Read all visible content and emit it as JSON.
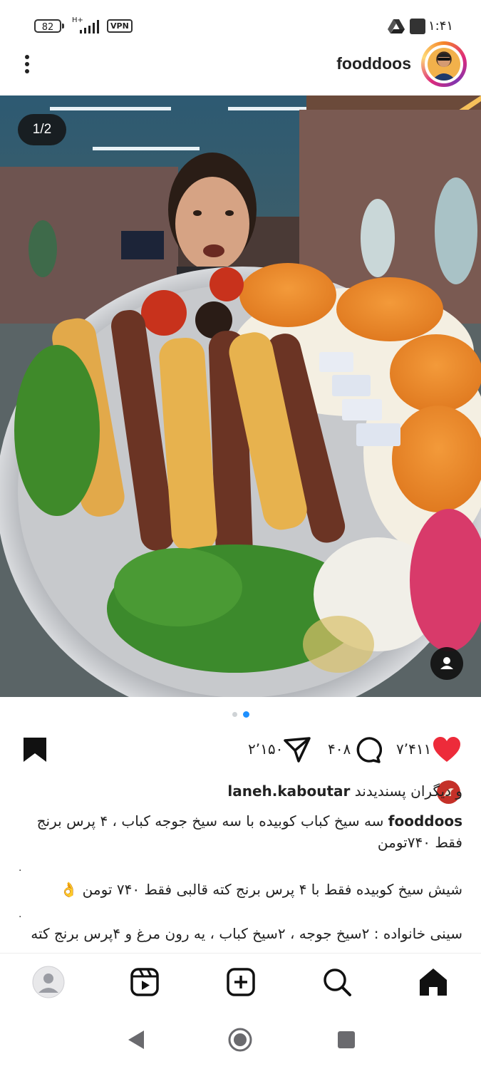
{
  "status_bar": {
    "battery": "82",
    "network_type": "H+",
    "vpn": "VPN",
    "time": "۱:۴۱"
  },
  "post_header": {
    "username": "fooddoos"
  },
  "photo": {
    "counter": "1/2",
    "description_icons": [
      "tag-people-icon"
    ]
  },
  "pagination": {
    "total": 2,
    "active_index": 1,
    "active_color": "#1e90ff",
    "inactive_color": "#cfd3d6"
  },
  "actions": {
    "likes": "۷٬۴۱۱",
    "comments": "۴۰۸",
    "shares": "۲٬۱۵۰",
    "like_color": "#ed2b3a"
  },
  "caption": {
    "liked_by_user": "laneh.kaboutar",
    "liked_by_suffix": "و دیگران پسندیدند",
    "author": "fooddoos",
    "line1": "سه سیخ کباب کوبیده با سه سیخ جوجه کباب ، ۴ پرس برنج",
    "line2": "فقط ۷۴۰تومن",
    "dot1": ".",
    "line3": "شیش سیخ کوبیده فقط با ۴ پرس برنج کته قالبی فقط ۷۴۰ تومن 👌",
    "dot2": ".",
    "line4": "سینی خانواده : ۲سیخ جوجه ، ۲سیخ کباب ، یه رون مرغ و ۴پرس برنج کته"
  },
  "bottom_nav": {
    "items": [
      "profile-tab",
      "reels-tab",
      "create-tab",
      "search-tab",
      "home-tab"
    ]
  }
}
